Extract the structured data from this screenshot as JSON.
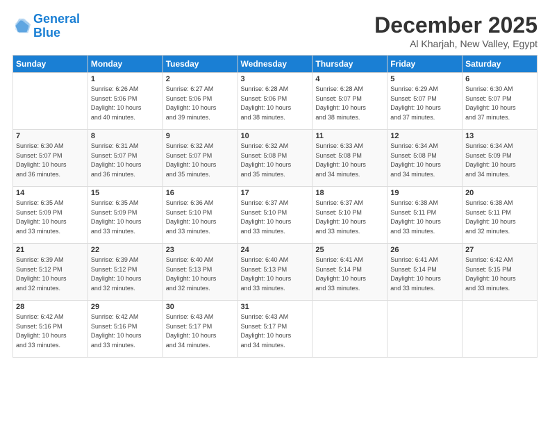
{
  "logo": {
    "line1": "General",
    "line2": "Blue"
  },
  "header": {
    "month": "December 2025",
    "location": "Al Kharjah, New Valley, Egypt"
  },
  "days_of_week": [
    "Sunday",
    "Monday",
    "Tuesday",
    "Wednesday",
    "Thursday",
    "Friday",
    "Saturday"
  ],
  "weeks": [
    [
      {
        "day": "",
        "info": ""
      },
      {
        "day": "1",
        "info": "Sunrise: 6:26 AM\nSunset: 5:06 PM\nDaylight: 10 hours\nand 40 minutes."
      },
      {
        "day": "2",
        "info": "Sunrise: 6:27 AM\nSunset: 5:06 PM\nDaylight: 10 hours\nand 39 minutes."
      },
      {
        "day": "3",
        "info": "Sunrise: 6:28 AM\nSunset: 5:06 PM\nDaylight: 10 hours\nand 38 minutes."
      },
      {
        "day": "4",
        "info": "Sunrise: 6:28 AM\nSunset: 5:07 PM\nDaylight: 10 hours\nand 38 minutes."
      },
      {
        "day": "5",
        "info": "Sunrise: 6:29 AM\nSunset: 5:07 PM\nDaylight: 10 hours\nand 37 minutes."
      },
      {
        "day": "6",
        "info": "Sunrise: 6:30 AM\nSunset: 5:07 PM\nDaylight: 10 hours\nand 37 minutes."
      }
    ],
    [
      {
        "day": "7",
        "info": "Sunrise: 6:30 AM\nSunset: 5:07 PM\nDaylight: 10 hours\nand 36 minutes."
      },
      {
        "day": "8",
        "info": "Sunrise: 6:31 AM\nSunset: 5:07 PM\nDaylight: 10 hours\nand 36 minutes."
      },
      {
        "day": "9",
        "info": "Sunrise: 6:32 AM\nSunset: 5:07 PM\nDaylight: 10 hours\nand 35 minutes."
      },
      {
        "day": "10",
        "info": "Sunrise: 6:32 AM\nSunset: 5:08 PM\nDaylight: 10 hours\nand 35 minutes."
      },
      {
        "day": "11",
        "info": "Sunrise: 6:33 AM\nSunset: 5:08 PM\nDaylight: 10 hours\nand 34 minutes."
      },
      {
        "day": "12",
        "info": "Sunrise: 6:34 AM\nSunset: 5:08 PM\nDaylight: 10 hours\nand 34 minutes."
      },
      {
        "day": "13",
        "info": "Sunrise: 6:34 AM\nSunset: 5:09 PM\nDaylight: 10 hours\nand 34 minutes."
      }
    ],
    [
      {
        "day": "14",
        "info": "Sunrise: 6:35 AM\nSunset: 5:09 PM\nDaylight: 10 hours\nand 33 minutes."
      },
      {
        "day": "15",
        "info": "Sunrise: 6:35 AM\nSunset: 5:09 PM\nDaylight: 10 hours\nand 33 minutes."
      },
      {
        "day": "16",
        "info": "Sunrise: 6:36 AM\nSunset: 5:10 PM\nDaylight: 10 hours\nand 33 minutes."
      },
      {
        "day": "17",
        "info": "Sunrise: 6:37 AM\nSunset: 5:10 PM\nDaylight: 10 hours\nand 33 minutes."
      },
      {
        "day": "18",
        "info": "Sunrise: 6:37 AM\nSunset: 5:10 PM\nDaylight: 10 hours\nand 33 minutes."
      },
      {
        "day": "19",
        "info": "Sunrise: 6:38 AM\nSunset: 5:11 PM\nDaylight: 10 hours\nand 33 minutes."
      },
      {
        "day": "20",
        "info": "Sunrise: 6:38 AM\nSunset: 5:11 PM\nDaylight: 10 hours\nand 32 minutes."
      }
    ],
    [
      {
        "day": "21",
        "info": "Sunrise: 6:39 AM\nSunset: 5:12 PM\nDaylight: 10 hours\nand 32 minutes."
      },
      {
        "day": "22",
        "info": "Sunrise: 6:39 AM\nSunset: 5:12 PM\nDaylight: 10 hours\nand 32 minutes."
      },
      {
        "day": "23",
        "info": "Sunrise: 6:40 AM\nSunset: 5:13 PM\nDaylight: 10 hours\nand 32 minutes."
      },
      {
        "day": "24",
        "info": "Sunrise: 6:40 AM\nSunset: 5:13 PM\nDaylight: 10 hours\nand 33 minutes."
      },
      {
        "day": "25",
        "info": "Sunrise: 6:41 AM\nSunset: 5:14 PM\nDaylight: 10 hours\nand 33 minutes."
      },
      {
        "day": "26",
        "info": "Sunrise: 6:41 AM\nSunset: 5:14 PM\nDaylight: 10 hours\nand 33 minutes."
      },
      {
        "day": "27",
        "info": "Sunrise: 6:42 AM\nSunset: 5:15 PM\nDaylight: 10 hours\nand 33 minutes."
      }
    ],
    [
      {
        "day": "28",
        "info": "Sunrise: 6:42 AM\nSunset: 5:16 PM\nDaylight: 10 hours\nand 33 minutes."
      },
      {
        "day": "29",
        "info": "Sunrise: 6:42 AM\nSunset: 5:16 PM\nDaylight: 10 hours\nand 33 minutes."
      },
      {
        "day": "30",
        "info": "Sunrise: 6:43 AM\nSunset: 5:17 PM\nDaylight: 10 hours\nand 34 minutes."
      },
      {
        "day": "31",
        "info": "Sunrise: 6:43 AM\nSunset: 5:17 PM\nDaylight: 10 hours\nand 34 minutes."
      },
      {
        "day": "",
        "info": ""
      },
      {
        "day": "",
        "info": ""
      },
      {
        "day": "",
        "info": ""
      }
    ]
  ]
}
